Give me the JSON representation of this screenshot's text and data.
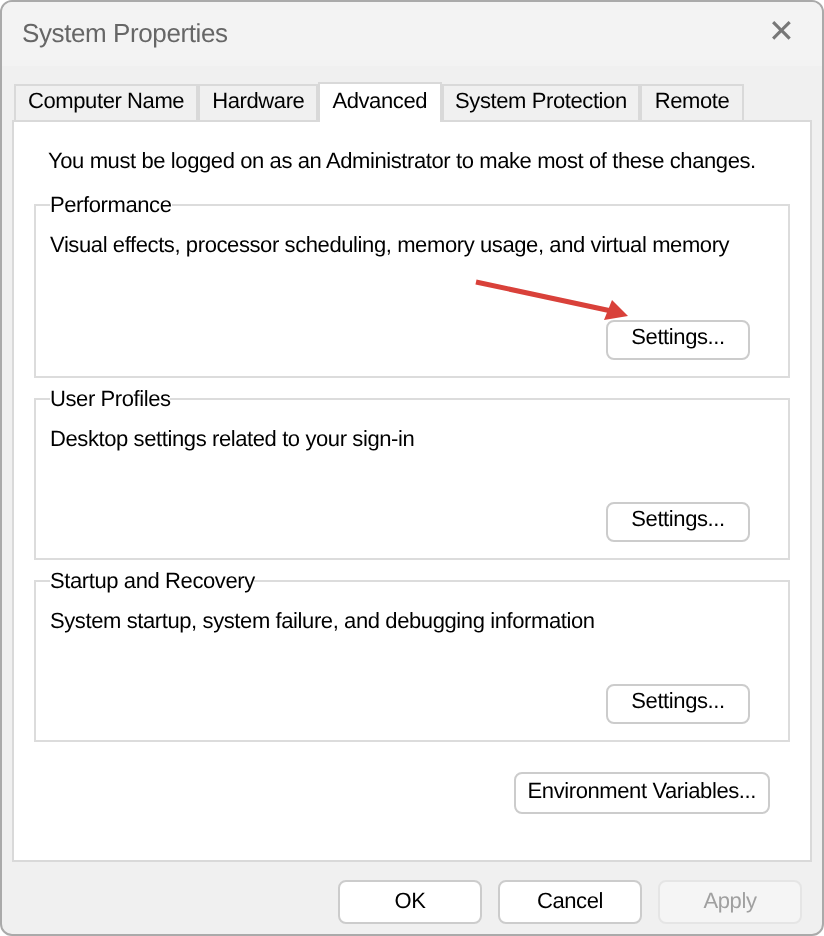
{
  "window": {
    "title": "System Properties",
    "close": "✕"
  },
  "tabs": [
    {
      "label": "Computer Name",
      "selected": false
    },
    {
      "label": "Hardware",
      "selected": false
    },
    {
      "label": "Advanced",
      "selected": true
    },
    {
      "label": "System Protection",
      "selected": false
    },
    {
      "label": "Remote",
      "selected": false
    }
  ],
  "notice": "You must be logged on as an Administrator to make most of these changes.",
  "groups": [
    {
      "title": "Performance",
      "description": "Visual effects, processor scheduling, memory usage, and virtual memory",
      "button": "Settings...",
      "annotated": true
    },
    {
      "title": "User Profiles",
      "description": "Desktop settings related to your sign-in",
      "button": "Settings...",
      "annotated": false
    },
    {
      "title": "Startup and Recovery",
      "description": "System startup, system failure, and debugging information",
      "button": "Settings...",
      "annotated": false
    }
  ],
  "environment_button": "Environment Variables...",
  "buttons": [
    {
      "label": "OK",
      "disabled": false
    },
    {
      "label": "Cancel",
      "disabled": false
    },
    {
      "label": "Apply",
      "disabled": true
    }
  ]
}
